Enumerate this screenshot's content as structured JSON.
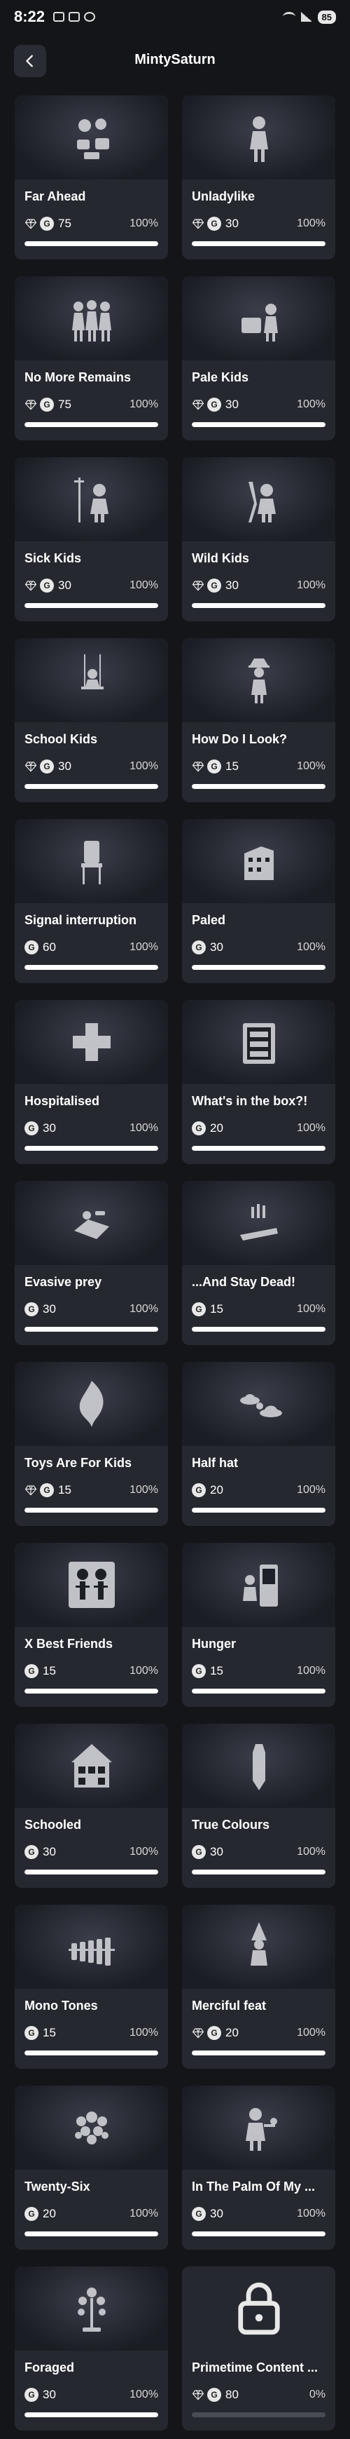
{
  "status_bar": {
    "time": "8:22",
    "battery": "85"
  },
  "header": {
    "title": "MintySaturn"
  },
  "achievements": [
    {
      "name": "Far Ahead",
      "gem": true,
      "points": "75",
      "percent": "100%",
      "progress": 1.0,
      "icon": "bird-cages-icon"
    },
    {
      "name": "Unladylike",
      "gem": true,
      "points": "30",
      "percent": "100%",
      "progress": 1.0,
      "icon": "girl-figure-icon"
    },
    {
      "name": "No More Remains",
      "gem": true,
      "points": "75",
      "percent": "100%",
      "progress": 1.0,
      "icon": "three-kids-icon"
    },
    {
      "name": "Pale Kids",
      "gem": true,
      "points": "30",
      "percent": "100%",
      "progress": 1.0,
      "icon": "kid-with-tv-icon"
    },
    {
      "name": "Sick Kids",
      "gem": true,
      "points": "30",
      "percent": "100%",
      "progress": 1.0,
      "icon": "iv-drip-kid-icon"
    },
    {
      "name": "Wild Kids",
      "gem": true,
      "points": "30",
      "percent": "100%",
      "progress": 1.0,
      "icon": "wild-kid-icon"
    },
    {
      "name": "School Kids",
      "gem": true,
      "points": "30",
      "percent": "100%",
      "progress": 1.0,
      "icon": "swing-kid-icon"
    },
    {
      "name": "How Do I Look?",
      "gem": true,
      "points": "15",
      "percent": "100%",
      "progress": 1.0,
      "icon": "hat-figure-icon"
    },
    {
      "name": "Signal interruption",
      "gem": false,
      "points": "60",
      "percent": "100%",
      "progress": 1.0,
      "icon": "chair-icon"
    },
    {
      "name": "Paled",
      "gem": false,
      "points": "30",
      "percent": "100%",
      "progress": 1.0,
      "icon": "building-icon"
    },
    {
      "name": "Hospitalised",
      "gem": false,
      "points": "30",
      "percent": "100%",
      "progress": 1.0,
      "icon": "medical-cross-icon"
    },
    {
      "name": "What's in the box?!",
      "gem": false,
      "points": "20",
      "percent": "100%",
      "progress": 1.0,
      "icon": "open-box-icon"
    },
    {
      "name": "Evasive prey",
      "gem": false,
      "points": "30",
      "percent": "100%",
      "progress": 1.0,
      "icon": "trap-icon"
    },
    {
      "name": "...And Stay Dead!",
      "gem": false,
      "points": "15",
      "percent": "100%",
      "progress": 1.0,
      "icon": "fallen-hand-icon"
    },
    {
      "name": "Toys Are For Kids",
      "gem": true,
      "points": "15",
      "percent": "100%",
      "progress": 1.0,
      "icon": "burning-toy-icon"
    },
    {
      "name": "Half hat",
      "gem": false,
      "points": "20",
      "percent": "100%",
      "progress": 1.0,
      "icon": "hats-icon"
    },
    {
      "name": "X Best Friends",
      "gem": false,
      "points": "15",
      "percent": "100%",
      "progress": 1.0,
      "icon": "skeletons-icon"
    },
    {
      "name": "Hunger",
      "gem": false,
      "points": "15",
      "percent": "100%",
      "progress": 1.0,
      "icon": "fridge-kid-icon"
    },
    {
      "name": "Schooled",
      "gem": false,
      "points": "30",
      "percent": "100%",
      "progress": 1.0,
      "icon": "dollhouse-icon"
    },
    {
      "name": "True Colours",
      "gem": false,
      "points": "30",
      "percent": "100%",
      "progress": 1.0,
      "icon": "crayon-icon"
    },
    {
      "name": "Mono Tones",
      "gem": false,
      "points": "15",
      "percent": "100%",
      "progress": 1.0,
      "icon": "xylophone-icon"
    },
    {
      "name": "Merciful feat",
      "gem": true,
      "points": "20",
      "percent": "100%",
      "progress": 1.0,
      "icon": "gnome-icon"
    },
    {
      "name": "Twenty-Six",
      "gem": false,
      "points": "20",
      "percent": "100%",
      "progress": 1.0,
      "icon": "flower-cluster-icon"
    },
    {
      "name": "In The Palm Of My ...",
      "gem": false,
      "points": "30",
      "percent": "100%",
      "progress": 1.0,
      "icon": "kid-holding-icon"
    },
    {
      "name": "Foraged",
      "gem": false,
      "points": "30",
      "percent": "100%",
      "progress": 1.0,
      "icon": "plant-icon"
    },
    {
      "name": "Primetime Content ...",
      "gem": true,
      "points": "80",
      "percent": "0%",
      "progress": 0.0,
      "icon": "lock-icon",
      "locked": true
    }
  ]
}
